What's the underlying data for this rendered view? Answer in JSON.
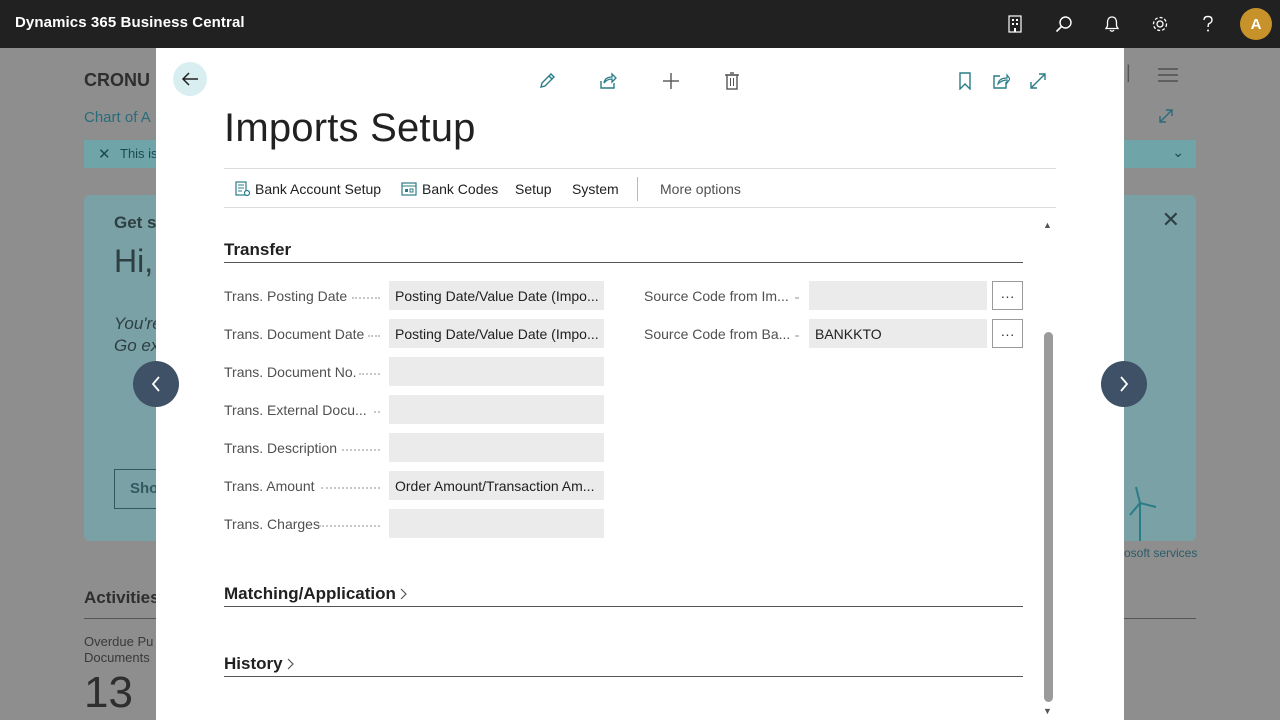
{
  "app": {
    "title": "Dynamics 365 Business Central",
    "avatar_initial": "A"
  },
  "background": {
    "company": "CRONU",
    "breadcrumb": "Chart of A",
    "notice": "This is",
    "card": {
      "heading": "Get s",
      "greeting": "Hi,",
      "line1": "You're",
      "line2": "Go ex",
      "button": "Sho"
    },
    "services_link": "osoft services",
    "activities_title": "Activities",
    "overdue_label_1": "Overdue Pu",
    "overdue_label_2": "Documents",
    "overdue_value": "13"
  },
  "dialog": {
    "title": "Imports Setup",
    "actions": [
      {
        "label": "Bank Account Setup",
        "icon": "bank-account-setup-icon"
      },
      {
        "label": "Bank Codes",
        "icon": "bank-codes-icon"
      },
      {
        "label": "Setup"
      },
      {
        "label": "System"
      },
      {
        "label": "More options"
      }
    ],
    "sections": {
      "transfer": {
        "title": "Transfer",
        "left_fields": [
          {
            "label": "Trans. Posting Date",
            "value": "Posting Date/Value Date (Impo..."
          },
          {
            "label": "Trans. Document Date",
            "value": "Posting Date/Value Date (Impo..."
          },
          {
            "label": "Trans. Document No.",
            "value": ""
          },
          {
            "label": "Trans. External Docu...",
            "value": ""
          },
          {
            "label": "Trans. Description",
            "value": ""
          },
          {
            "label": "Trans. Amount",
            "value": "Order Amount/Transaction Am..."
          },
          {
            "label": "Trans. Charges",
            "value": ""
          }
        ],
        "right_fields": [
          {
            "label": "Source Code from Im...",
            "value": ""
          },
          {
            "label": "Source Code from Ba...",
            "value": "BANKKTO"
          }
        ]
      },
      "matching": {
        "title": "Matching/Application"
      },
      "history": {
        "title": "History"
      }
    }
  }
}
